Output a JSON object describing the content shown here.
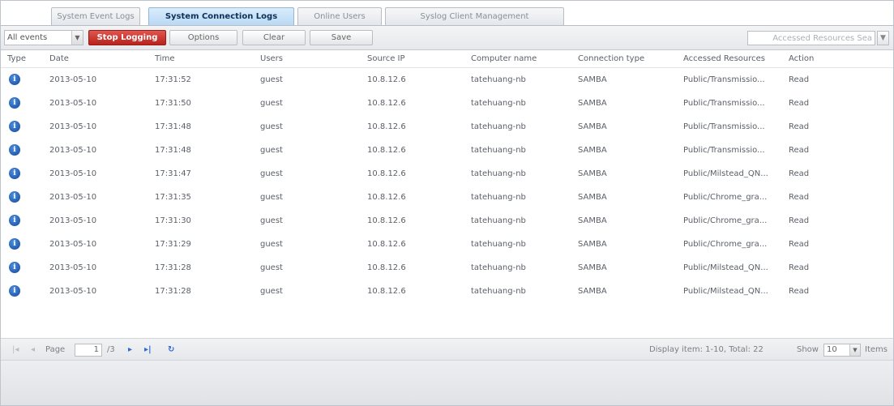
{
  "tabs": [
    {
      "label": "System Event Logs",
      "active": false
    },
    {
      "label": "System Connection Logs",
      "active": true
    },
    {
      "label": "Online Users",
      "active": false
    },
    {
      "label": "Syslog Client Management",
      "active": false
    }
  ],
  "toolbar": {
    "filter_value": "All events",
    "stop_logging_label": "Stop Logging",
    "options_label": "Options",
    "clear_label": "Clear",
    "save_label": "Save",
    "search_placeholder": "Accessed Resources Sea"
  },
  "columns": [
    "Type",
    "Date",
    "Time",
    "Users",
    "Source IP",
    "Computer name",
    "Connection type",
    "Accessed Resources",
    "Action"
  ],
  "rows": [
    {
      "type": "info-icon",
      "date": "2013-05-10",
      "time": "17:31:52",
      "user": "guest",
      "ip": "10.8.12.6",
      "computer": "tatehuang-nb",
      "conn": "SAMBA",
      "resource": "Public/Transmissio...",
      "action": "Read"
    },
    {
      "type": "info-icon",
      "date": "2013-05-10",
      "time": "17:31:50",
      "user": "guest",
      "ip": "10.8.12.6",
      "computer": "tatehuang-nb",
      "conn": "SAMBA",
      "resource": "Public/Transmissio...",
      "action": "Read"
    },
    {
      "type": "info-icon",
      "date": "2013-05-10",
      "time": "17:31:48",
      "user": "guest",
      "ip": "10.8.12.6",
      "computer": "tatehuang-nb",
      "conn": "SAMBA",
      "resource": "Public/Transmissio...",
      "action": "Read"
    },
    {
      "type": "info-icon",
      "date": "2013-05-10",
      "time": "17:31:48",
      "user": "guest",
      "ip": "10.8.12.6",
      "computer": "tatehuang-nb",
      "conn": "SAMBA",
      "resource": "Public/Transmissio...",
      "action": "Read"
    },
    {
      "type": "info-icon",
      "date": "2013-05-10",
      "time": "17:31:47",
      "user": "guest",
      "ip": "10.8.12.6",
      "computer": "tatehuang-nb",
      "conn": "SAMBA",
      "resource": "Public/Milstead_QN...",
      "action": "Read"
    },
    {
      "type": "info-icon",
      "date": "2013-05-10",
      "time": "17:31:35",
      "user": "guest",
      "ip": "10.8.12.6",
      "computer": "tatehuang-nb",
      "conn": "SAMBA",
      "resource": "Public/Chrome_gra...",
      "action": "Read"
    },
    {
      "type": "info-icon",
      "date": "2013-05-10",
      "time": "17:31:30",
      "user": "guest",
      "ip": "10.8.12.6",
      "computer": "tatehuang-nb",
      "conn": "SAMBA",
      "resource": "Public/Chrome_gra...",
      "action": "Read"
    },
    {
      "type": "info-icon",
      "date": "2013-05-10",
      "time": "17:31:29",
      "user": "guest",
      "ip": "10.8.12.6",
      "computer": "tatehuang-nb",
      "conn": "SAMBA",
      "resource": "Public/Chrome_gra...",
      "action": "Read"
    },
    {
      "type": "info-icon",
      "date": "2013-05-10",
      "time": "17:31:28",
      "user": "guest",
      "ip": "10.8.12.6",
      "computer": "tatehuang-nb",
      "conn": "SAMBA",
      "resource": "Public/Milstead_QN...",
      "action": "Read"
    },
    {
      "type": "info-icon",
      "date": "2013-05-10",
      "time": "17:31:28",
      "user": "guest",
      "ip": "10.8.12.6",
      "computer": "tatehuang-nb",
      "conn": "SAMBA",
      "resource": "Public/Milstead_QN...",
      "action": "Read"
    }
  ],
  "pager": {
    "page_label": "Page",
    "page_value": "1",
    "total_pages": "/3",
    "display_text": "Display item: 1-10, Total: 22",
    "show_label": "Show",
    "show_value": "10",
    "items_label": "Items"
  },
  "colors": {
    "accent": "#b9d9f4",
    "stop_button": "#c9302c",
    "info_icon": "#1d5bb8"
  }
}
